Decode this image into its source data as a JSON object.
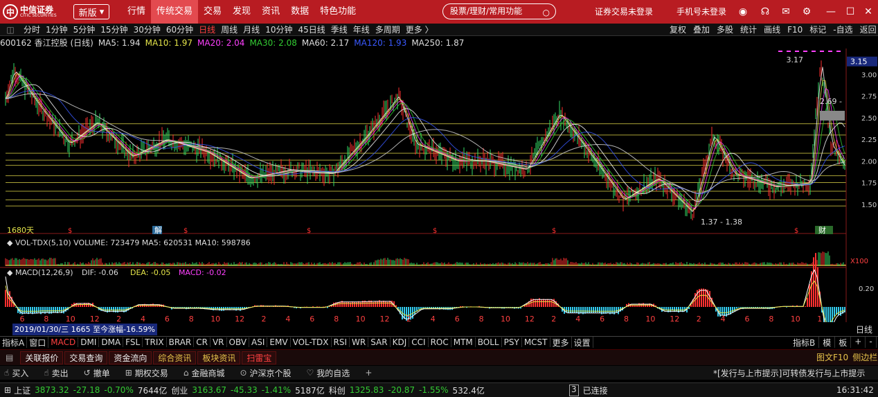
{
  "titlebar": {
    "brand": "中信证券",
    "brand_en": "CITIC SECURITIES",
    "version_btn": "新版",
    "nav": [
      {
        "label": "行情"
      },
      {
        "label": "传统交易",
        "active": true
      },
      {
        "label": "交易"
      },
      {
        "label": "发现"
      },
      {
        "label": "资讯"
      },
      {
        "label": "数据"
      },
      {
        "label": "特色功能"
      }
    ],
    "search_placeholder": "股票/理财/常用功能",
    "login_trade": "证券交易未登录",
    "login_phone": "手机号未登录"
  },
  "periodbar": {
    "periods": [
      "分时",
      "1分钟",
      "5分钟",
      "15分钟",
      "30分钟",
      "60分钟",
      "日线",
      "周线",
      "月线",
      "10分钟",
      "45日线",
      "季线",
      "年线",
      "多周期",
      "更多 〉"
    ],
    "active": "日线",
    "right": [
      "复权",
      "叠加",
      "多股",
      "统计",
      "画线",
      "F10",
      "标记",
      "-自选",
      "返回"
    ]
  },
  "maline": {
    "code": "600162 香江控股 (日线)",
    "items": [
      {
        "label": "MA5: 1.94",
        "color": "#dddddd"
      },
      {
        "label": "MA10: 1.97",
        "color": "#e6e64a"
      },
      {
        "label": "MA20: 2.04",
        "color": "#ff40ff"
      },
      {
        "label": "MA30: 2.08",
        "color": "#33cc33"
      },
      {
        "label": "MA60: 2.17",
        "color": "#dddddd"
      },
      {
        "label": "MA120: 1.93",
        "color": "#3a5aff"
      },
      {
        "label": "MA250: 1.87",
        "color": "#dddddd"
      }
    ]
  },
  "chart_data": {
    "type": "line",
    "price_ticks": [
      "3.15",
      "3.00",
      "2.75",
      "2.50",
      "2.25",
      "2.00",
      "1.75",
      "1.50"
    ],
    "hi_label": "3.17",
    "mid_label": "2.69 -",
    "lo_labels": [
      "1.37 - 1.38"
    ],
    "days_label": "1680天",
    "event_marker": "解",
    "report_marker": "财",
    "vol_line": "VOL-TDX(5,10)  VOLUME: 723479  MA5: 620531  MA10: 598786",
    "vol_scale": "X100",
    "macd_line_label": "MACD(12,26,9)",
    "macd_vals": [
      {
        "label": "DIF: -0.06",
        "color": "#dddddd"
      },
      {
        "label": "DEA: -0.05",
        "color": "#e6e64a"
      },
      {
        "label": "MACD: -0.02",
        "color": "#ff40ff"
      }
    ],
    "macd_tick": "0.20",
    "months": [
      "6",
      "8",
      "10",
      "12",
      "2",
      "4",
      "6",
      "8",
      "10",
      "12",
      "2",
      "4",
      "6",
      "8",
      "10",
      "12",
      "2",
      "4",
      "6",
      "8",
      "10",
      "12",
      "2",
      "4",
      "6",
      "8",
      "10",
      "12",
      "2",
      "4",
      "6",
      "8",
      "10",
      "1"
    ]
  },
  "datebar": {
    "datebox": "2019/01/30/三 1665 至今涨幅-16.59%",
    "right": "日线"
  },
  "indbar": {
    "items": [
      "指标A",
      "窗口",
      "MACD",
      "DMI",
      "DMA",
      "FSL",
      "TRIX",
      "BRAR",
      "CR",
      "VR",
      "OBV",
      "ASI",
      "EMV",
      "VOL-TDX",
      "RSI",
      "WR",
      "SAR",
      "KDJ",
      "CCI",
      "ROC",
      "MTM",
      "BOLL",
      "PSY",
      "MCST",
      "更多",
      "设置"
    ],
    "active": "MACD",
    "right": [
      "指标B",
      "模",
      "板",
      "+",
      "-"
    ]
  },
  "panelbar": {
    "tabs": [
      "关联报价",
      "交易查询",
      "资金流向",
      "综合资讯",
      "板块资讯",
      "扫雷宝"
    ],
    "right": [
      "图文F10",
      "侧边栏"
    ]
  },
  "tools": {
    "items": [
      {
        "icon": "☝",
        "label": "买入"
      },
      {
        "icon": "☝",
        "label": "卖出"
      },
      {
        "icon": "↺",
        "label": "撤单"
      },
      {
        "icon": "⊞",
        "label": "期权交易"
      },
      {
        "icon": "⌂",
        "label": "金融商城"
      },
      {
        "icon": "⊙",
        "label": "沪深京个股"
      },
      {
        "icon": "♡",
        "label": "我的自选"
      },
      {
        "icon": "+",
        "label": ""
      }
    ],
    "notice": "*[发行与上市提示]可转债发行与上市提示"
  },
  "status": {
    "sh": {
      "label": "上证",
      "v": "3873.32",
      "c": "-27.18",
      "p": "-0.70%",
      "a": "7644亿"
    },
    "cy": {
      "label": "创业",
      "v": "3163.67",
      "c": "-45.33",
      "p": "-1.41%",
      "a": "5187亿"
    },
    "kc": {
      "label": "科创",
      "v": "1325.83",
      "c": "-20.87",
      "p": "-1.55%",
      "a": "532.4亿"
    },
    "conn": "已连接",
    "conn_n": "3",
    "time": "16:31:42"
  }
}
